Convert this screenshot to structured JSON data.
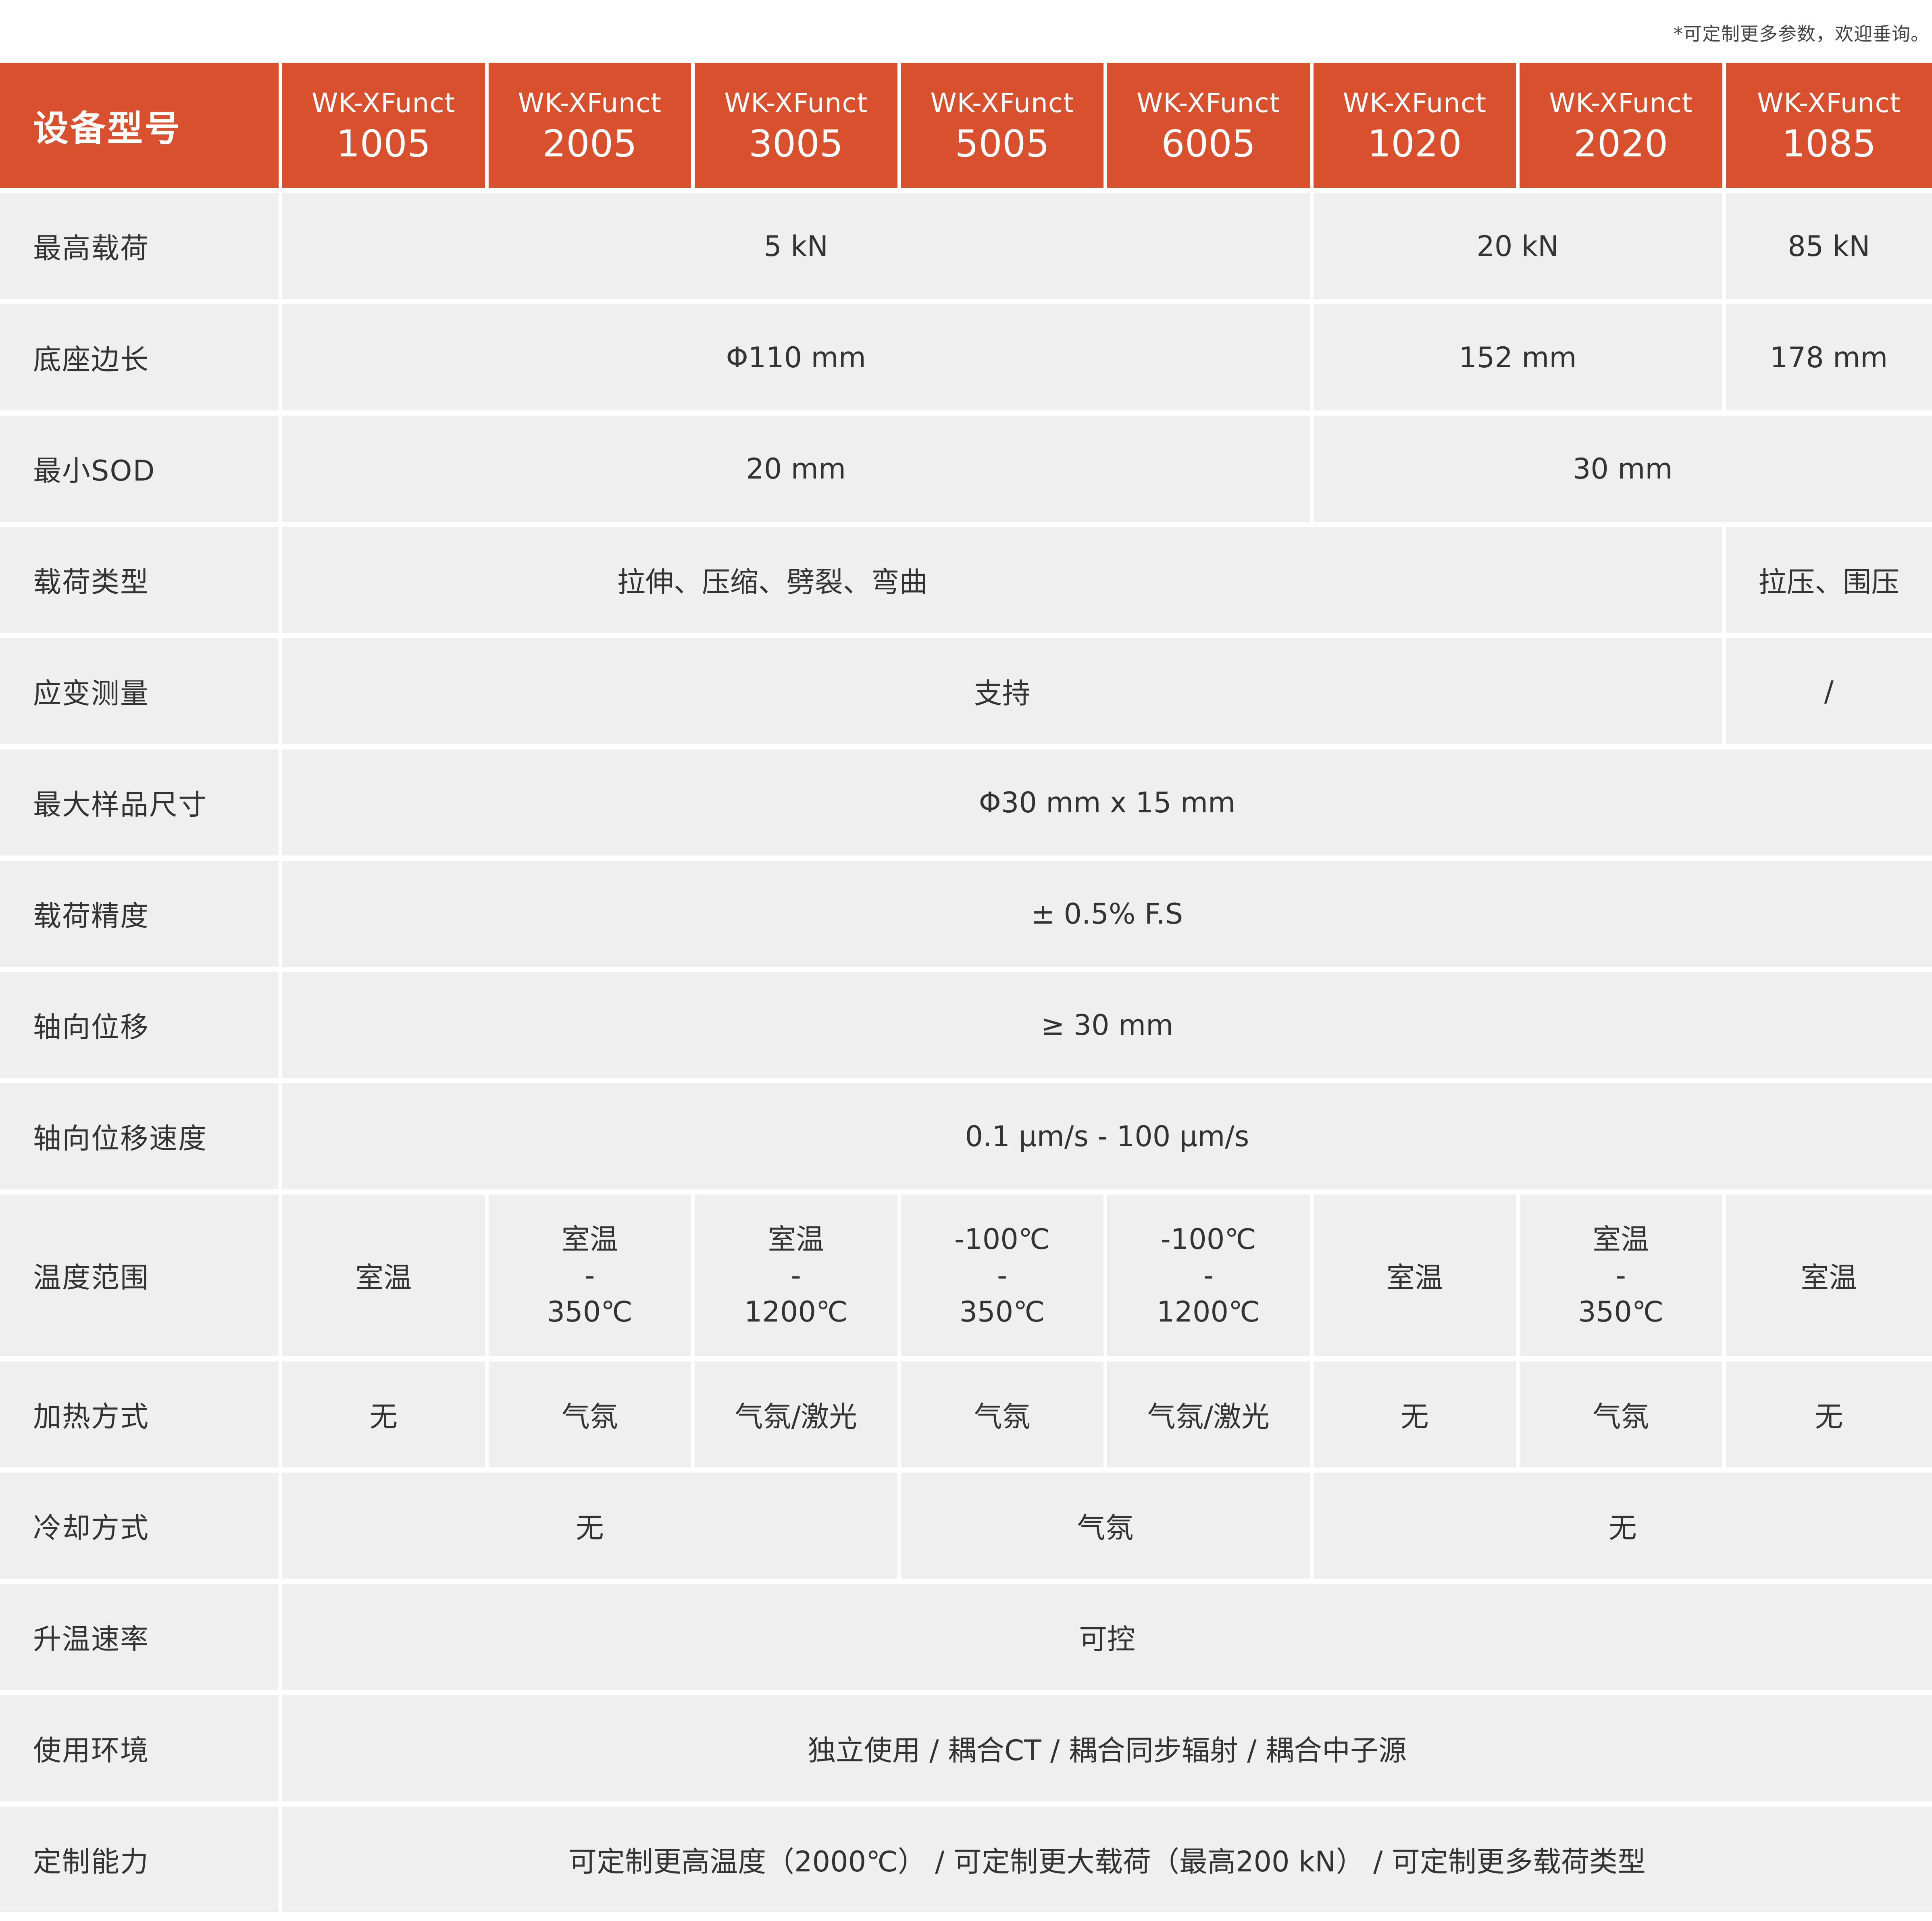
{
  "note": "*可定制更多参数，欢迎垂询。",
  "header": {
    "label": "设备型号",
    "model_prefix": "WK-XFunct",
    "models": [
      "1005",
      "2005",
      "3005",
      "5005",
      "6005",
      "1020",
      "2020",
      "1085"
    ]
  },
  "rows": {
    "max_load": {
      "label": "最高载荷",
      "v1": "5 kN",
      "v2": "20 kN",
      "v3": "85 kN"
    },
    "base_side": {
      "label": "底座边长",
      "v1": "Φ110 mm",
      "v2": "152 mm",
      "v3": "178 mm"
    },
    "min_sod": {
      "label": "最小SOD",
      "v1": "20 mm",
      "v2": "30 mm"
    },
    "load_type": {
      "label": "载荷类型",
      "v1": "拉伸、压缩、劈裂、弯曲",
      "v2": "拉压、围压"
    },
    "strain": {
      "label": "应变测量",
      "v1": "支持",
      "v2": "/"
    },
    "max_sample": {
      "label": "最大样品尺寸",
      "v1": "Φ30 mm x 15 mm"
    },
    "load_accuracy": {
      "label": "载荷精度",
      "v1": "± 0.5% F.S"
    },
    "axial_disp": {
      "label": "轴向位移",
      "v1": "≥ 30 mm"
    },
    "axial_speed": {
      "label": "轴向位移速度",
      "v1": "0.1 μm/s - 100 μm/s"
    },
    "temp_range": {
      "label": "温度范围",
      "c1": "室温",
      "c2": {
        "top": "室温",
        "mid": "-",
        "bot": "350℃"
      },
      "c3": {
        "top": "室温",
        "mid": "-",
        "bot": "1200℃"
      },
      "c4": {
        "top": "-100℃",
        "mid": "-",
        "bot": "350℃"
      },
      "c5": {
        "top": "-100℃",
        "mid": "-",
        "bot": "1200℃"
      },
      "c6": "室温",
      "c7": {
        "top": "室温",
        "mid": "-",
        "bot": "350℃"
      },
      "c8": "室温"
    },
    "heating": {
      "label": "加热方式",
      "values": [
        "无",
        "气氛",
        "气氛/激光",
        "气氛",
        "气氛/激光",
        "无",
        "气氛",
        "无"
      ]
    },
    "cooling": {
      "label": "冷却方式",
      "v1": "无",
      "v2": "气氛",
      "v3": "无"
    },
    "heat_rate": {
      "label": "升温速率",
      "v1": "可控"
    },
    "environment": {
      "label": "使用环境",
      "v1": "独立使用 / 耦合CT / 耦合同步辐射 / 耦合中子源"
    },
    "customization": {
      "label": "定制能力",
      "v1": "可定制更高温度（2000℃） / 可定制更大载荷（最高200 kN） / 可定制更多载荷类型"
    }
  }
}
